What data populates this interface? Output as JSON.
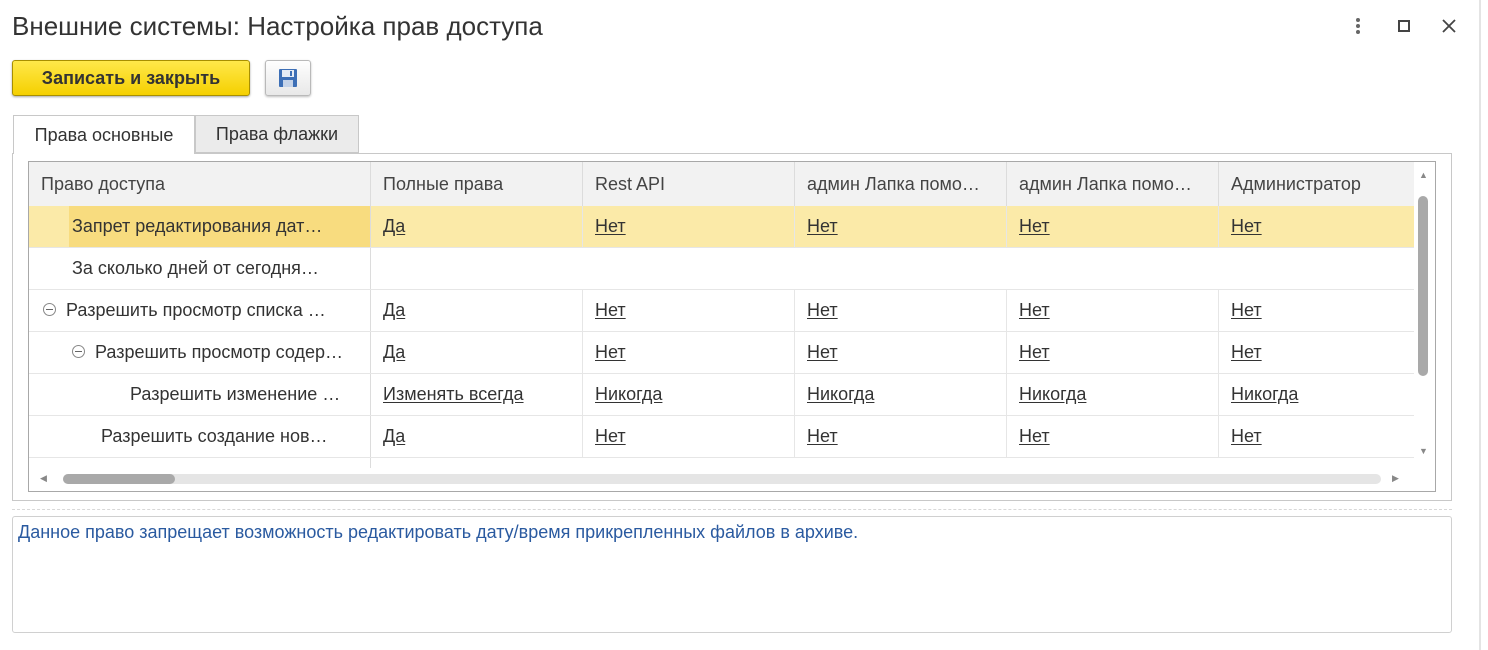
{
  "window": {
    "title": "Внешние системы: Настройка прав доступа",
    "menu_icon": "more-vertical-icon",
    "maximize_icon": "maximize-icon",
    "close_icon": "close-icon"
  },
  "toolbar": {
    "save_close_label": "Записать и закрыть",
    "save_icon": "floppy-disk-icon",
    "accent_color": "#f5d000"
  },
  "tabs": [
    {
      "label": "Права основные",
      "active": true
    },
    {
      "label": "Права флажки",
      "active": false
    }
  ],
  "table": {
    "columns": [
      "Право доступа",
      "Полные права",
      "Rest API",
      "админ Лапка помо…",
      "админ Лапка помо…",
      "Администратор"
    ],
    "rows": [
      {
        "name": "Запрет редактирования дат…",
        "values": [
          "Да",
          "Нет",
          "Нет",
          "Нет",
          "Нет"
        ],
        "selected": true
      },
      {
        "name": "За сколько дней от сегодня…",
        "values": [
          "",
          "",
          "",
          "",
          ""
        ]
      },
      {
        "name": "Разрешить просмотр списка …",
        "values": [
          "Да",
          "Нет",
          "Нет",
          "Нет",
          "Нет"
        ],
        "collapsible": true
      },
      {
        "name": "Разрешить просмотр содер…",
        "values": [
          "Да",
          "Нет",
          "Нет",
          "Нет",
          "Нет"
        ],
        "collapsible": true
      },
      {
        "name": "Разрешить изменение …",
        "values": [
          "Изменять всегда",
          "Никогда",
          "Никогда",
          "Никогда",
          "Никогда"
        ]
      },
      {
        "name": "Разрешить создание нов…",
        "values": [
          "Да",
          "Нет",
          "Нет",
          "Нет",
          "Нет"
        ]
      }
    ],
    "selected_row_color": "#fbeaa8"
  },
  "description": {
    "text": "Данное право запрещает возможность редактировать дату/время прикрепленных файлов в архиве."
  }
}
